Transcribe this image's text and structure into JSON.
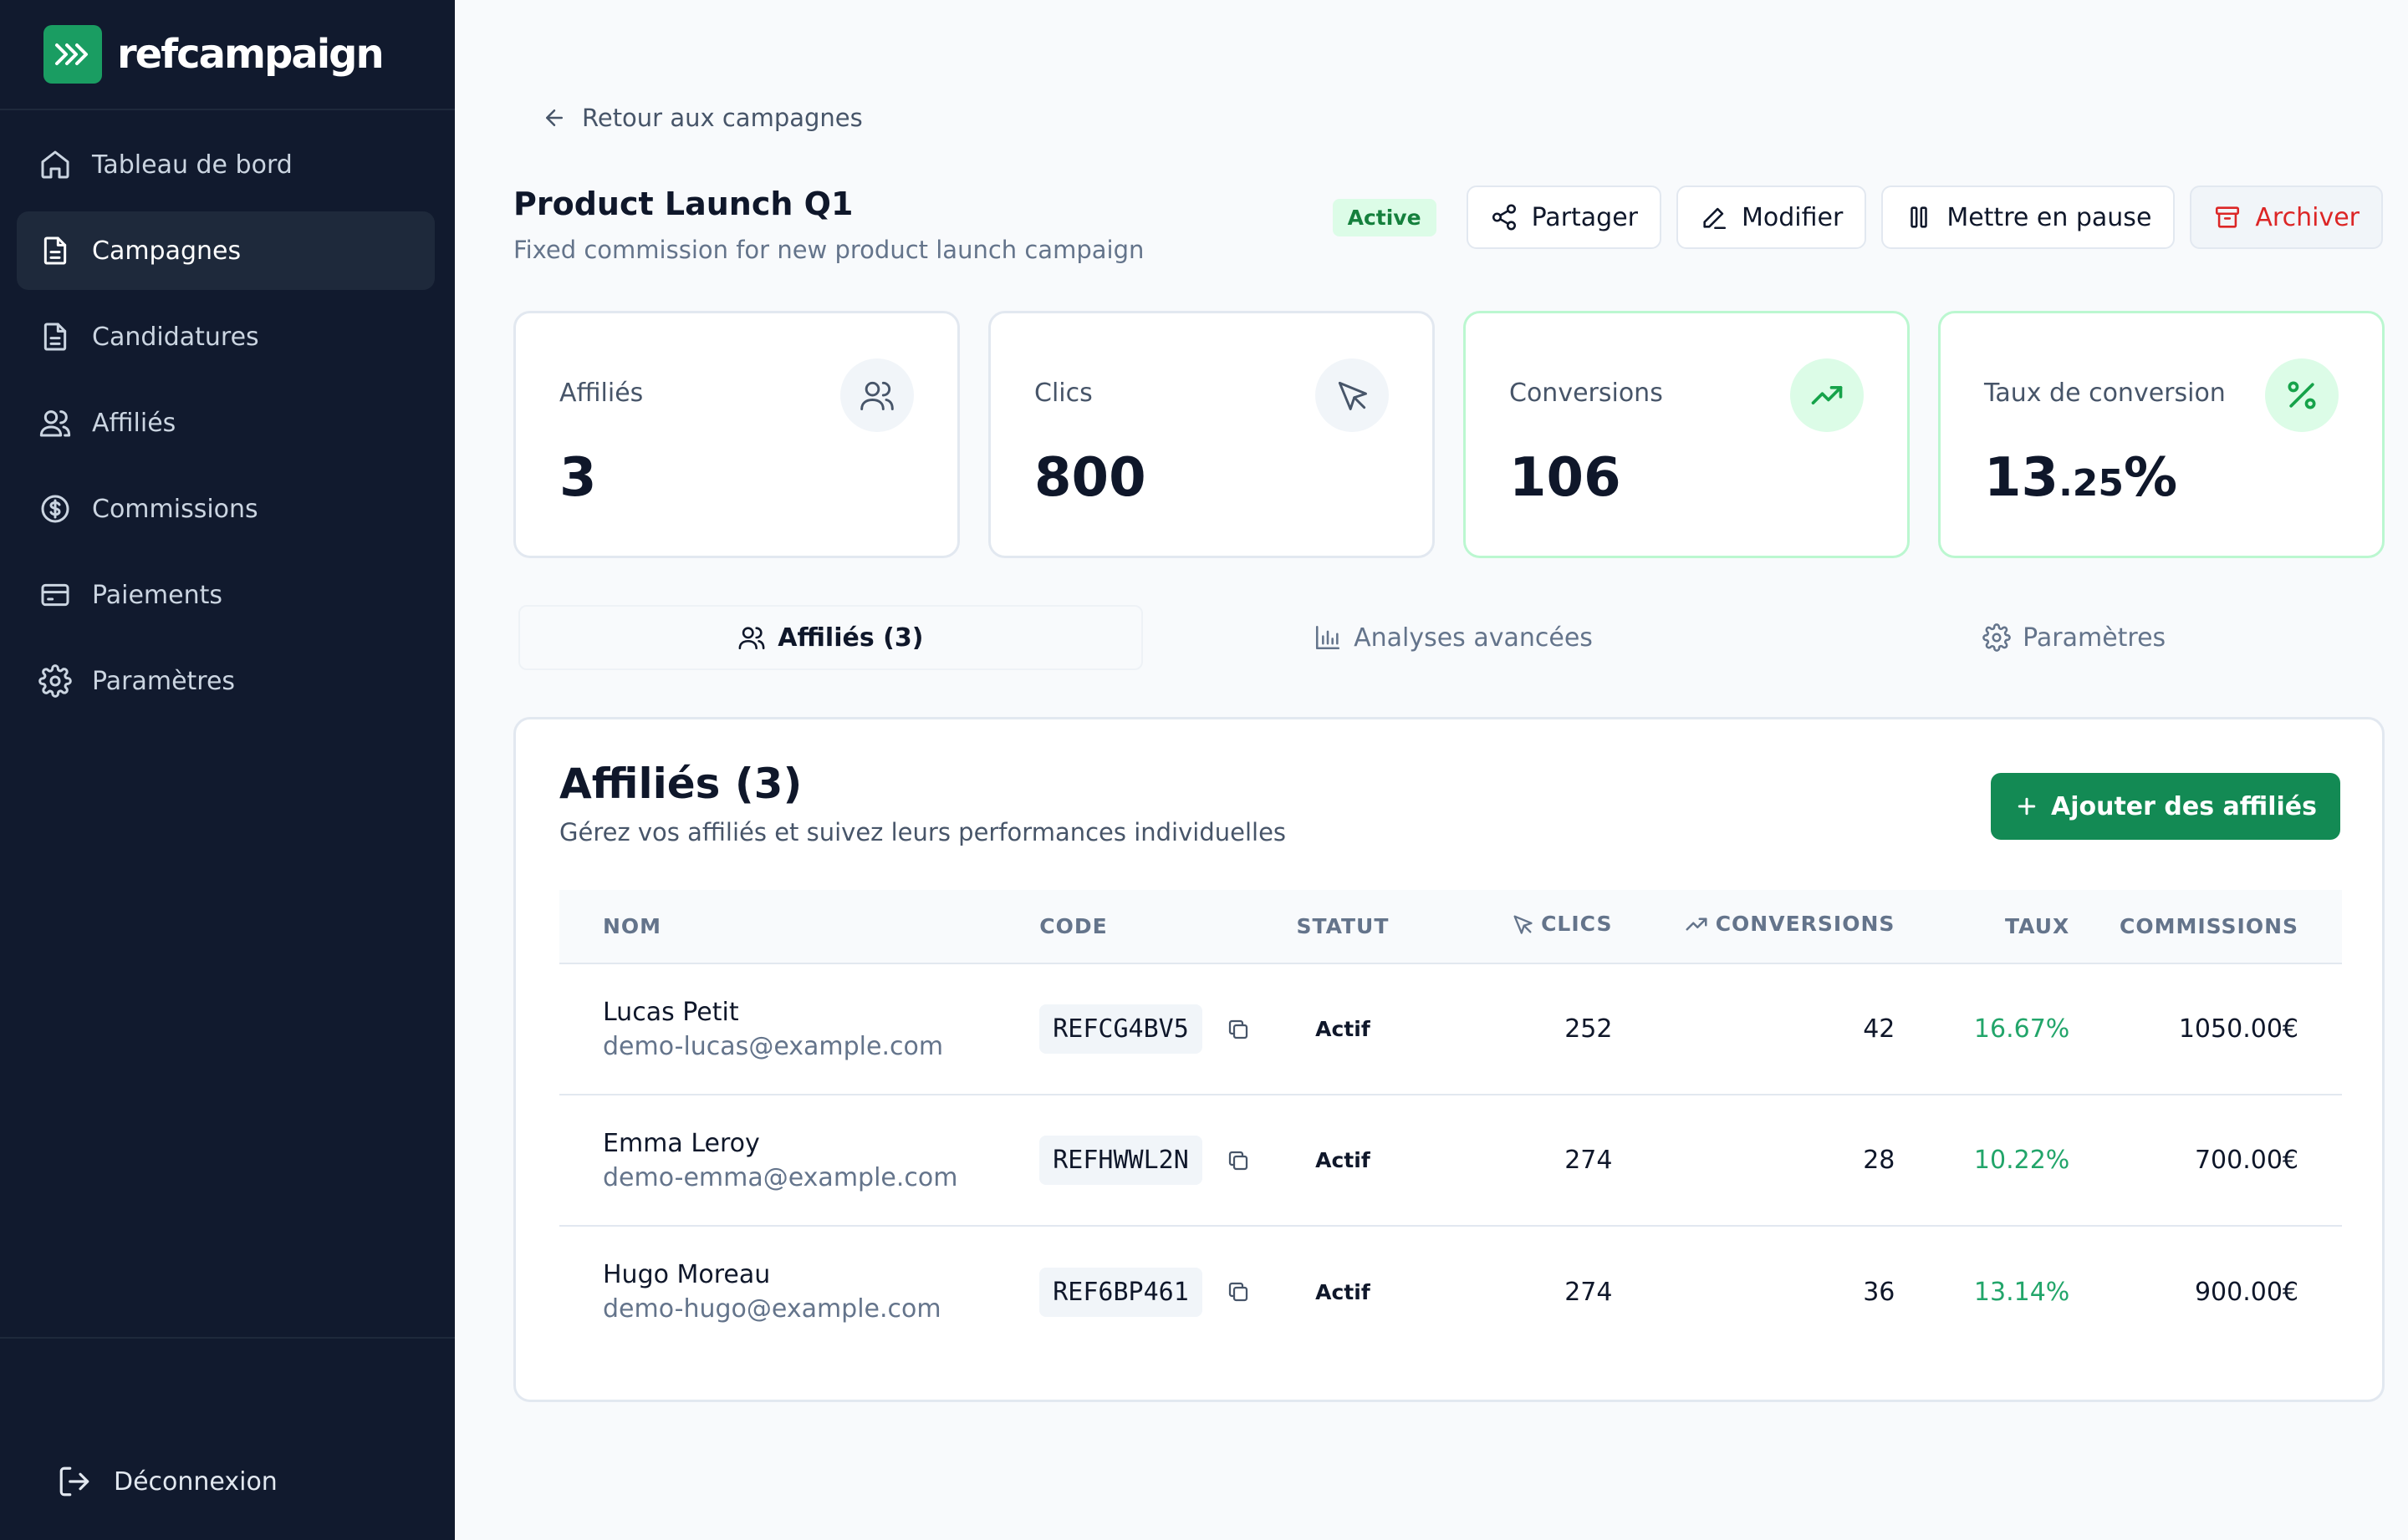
{
  "brand": {
    "name": "refcampaign"
  },
  "sidebar": {
    "items": [
      {
        "label": "Tableau de bord",
        "icon": "home-icon"
      },
      {
        "label": "Campagnes",
        "icon": "document-icon",
        "active": true
      },
      {
        "label": "Candidatures",
        "icon": "document-icon"
      },
      {
        "label": "Affiliés",
        "icon": "users-icon"
      },
      {
        "label": "Commissions",
        "icon": "dollar-icon"
      },
      {
        "label": "Paiements",
        "icon": "credit-card-icon"
      },
      {
        "label": "Paramètres",
        "icon": "gear-icon"
      }
    ],
    "logout_label": "Déconnexion"
  },
  "header": {
    "back_label": "Retour aux campagnes",
    "title": "Product Launch Q1",
    "subtitle": "Fixed commission for new product launch campaign",
    "status_badge": "Active",
    "share_label": "Partager",
    "edit_label": "Modifier",
    "pause_label": "Mettre en pause",
    "archive_label": "Archiver"
  },
  "stats": [
    {
      "label": "Affiliés",
      "value": "3",
      "icon": "users-icon"
    },
    {
      "label": "Clics",
      "value": "800",
      "icon": "cursor-icon"
    },
    {
      "label": "Conversions",
      "value": "106",
      "icon": "trending-up-icon"
    },
    {
      "label": "Taux de conversion",
      "value_main": "13",
      "value_decimal": ".25",
      "value_suffix": "%",
      "icon": "percent-icon"
    }
  ],
  "tabs": [
    {
      "label": "Affiliés (3)",
      "active": true
    },
    {
      "label": "Analyses avancées"
    },
    {
      "label": "Paramètres"
    }
  ],
  "panel": {
    "title": "Affiliés (3)",
    "subtitle": "Gérez vos affiliés et suivez leurs performances individuelles",
    "add_label": "Ajouter des affiliés"
  },
  "table": {
    "columns": [
      "NOM",
      "CODE",
      "STATUT",
      "CLICS",
      "CONVERSIONS",
      "TAUX",
      "COMMISSIONS"
    ],
    "rows": [
      {
        "name": "Lucas Petit",
        "email": "demo-lucas@example.com",
        "code": "REFCG4BV5",
        "status": "Actif",
        "clicks": "252",
        "conversions": "42",
        "rate": "16.67%",
        "commission": "1050.00€"
      },
      {
        "name": "Emma Leroy",
        "email": "demo-emma@example.com",
        "code": "REFHWWL2N",
        "status": "Actif",
        "clicks": "274",
        "conversions": "28",
        "rate": "10.22%",
        "commission": "700.00€"
      },
      {
        "name": "Hugo Moreau",
        "email": "demo-hugo@example.com",
        "code": "REF6BP461",
        "status": "Actif",
        "clicks": "274",
        "conversions": "36",
        "rate": "13.14%",
        "commission": "900.00€"
      }
    ]
  },
  "colors": {
    "sidebar_bg": "#111a2e",
    "brand_green": "#1a9d62",
    "primary": "#138a54",
    "danger": "#dc2626",
    "rate_green": "#22a56a"
  }
}
